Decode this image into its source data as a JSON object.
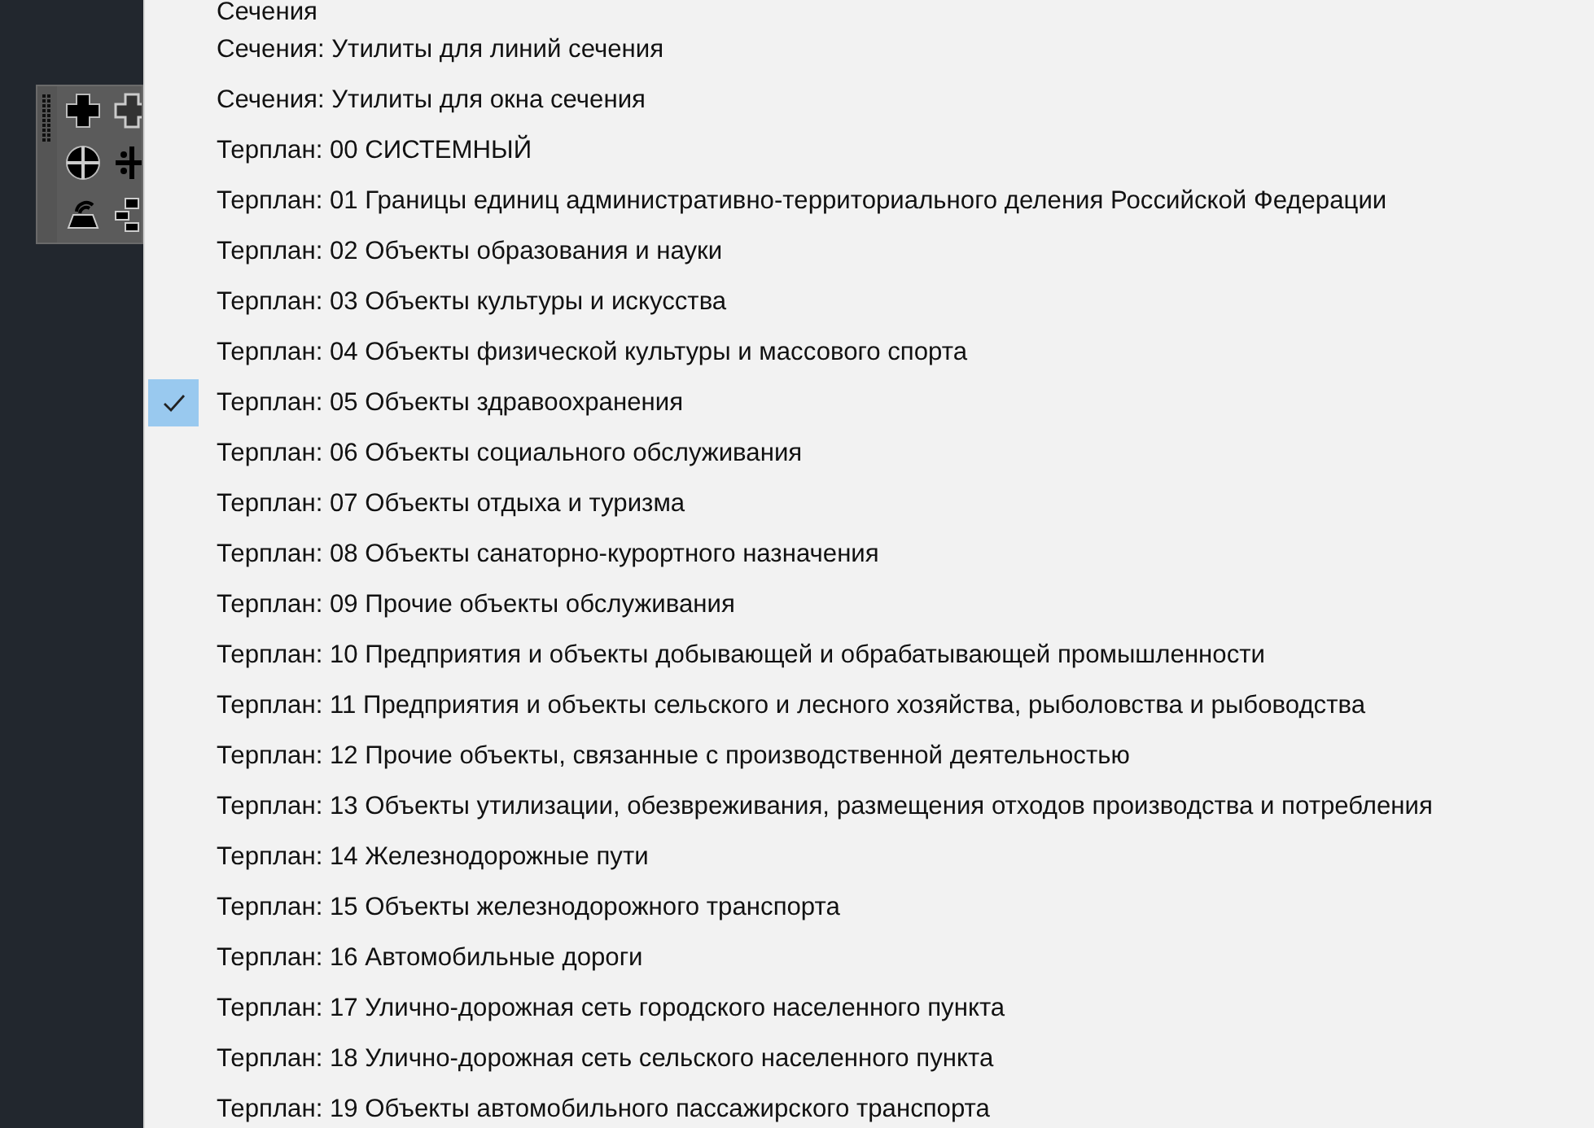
{
  "menu": {
    "items": [
      {
        "label": "Сечения",
        "checked": false
      },
      {
        "label": "Сечения: Утилиты для линий сечения",
        "checked": false
      },
      {
        "label": "Сечения: Утилиты для окна сечения",
        "checked": false
      },
      {
        "label": "Терплан: 00 СИСТЕМНЫЙ",
        "checked": false
      },
      {
        "label": "Терплан: 01 Границы единиц административно-территориального деления Российской Федерации",
        "checked": false
      },
      {
        "label": "Терплан: 02 Объекты образования и науки",
        "checked": false
      },
      {
        "label": "Терплан: 03 Объекты культуры и искусства",
        "checked": false
      },
      {
        "label": "Терплан: 04 Объекты физической культуры и массового спорта",
        "checked": false
      },
      {
        "label": "Терплан: 05 Объекты здравоохранения",
        "checked": true
      },
      {
        "label": "Терплан: 06 Объекты социального обслуживания",
        "checked": false
      },
      {
        "label": "Терплан: 07 Объекты отдыха и туризма",
        "checked": false
      },
      {
        "label": "Терплан: 08 Объекты санаторно-курортного назначения",
        "checked": false
      },
      {
        "label": "Терплан: 09 Прочие объекты обслуживания",
        "checked": false
      },
      {
        "label": "Терплан: 10 Предприятия и объекты добывающей и обрабатывающей промышленности",
        "checked": false
      },
      {
        "label": "Терплан: 11 Предприятия и объекты сельского и лесного хозяйства, рыболовства и рыбоводства",
        "checked": false
      },
      {
        "label": "Терплан: 12 Прочие объекты, связанные с производственной деятельностью",
        "checked": false
      },
      {
        "label": "Терплан: 13 Объекты утилизации, обезвреживания, размещения отходов производства и потребления",
        "checked": false
      },
      {
        "label": "Терплан: 14 Железнодорожные пути",
        "checked": false
      },
      {
        "label": "Терплан: 15 Объекты железнодорожного транспорта",
        "checked": false
      },
      {
        "label": "Терплан: 16 Автомобильные дороги",
        "checked": false
      },
      {
        "label": "Терплан: 17 Улично-дорожная сеть городского населенного пункта",
        "checked": false
      },
      {
        "label": "Терплан: 18 Улично-дорожная сеть сельского населенного пункта",
        "checked": false
      },
      {
        "label": "Терплан: 19 Объекты автомобильного пассажирского транспорта",
        "checked": false
      }
    ]
  }
}
